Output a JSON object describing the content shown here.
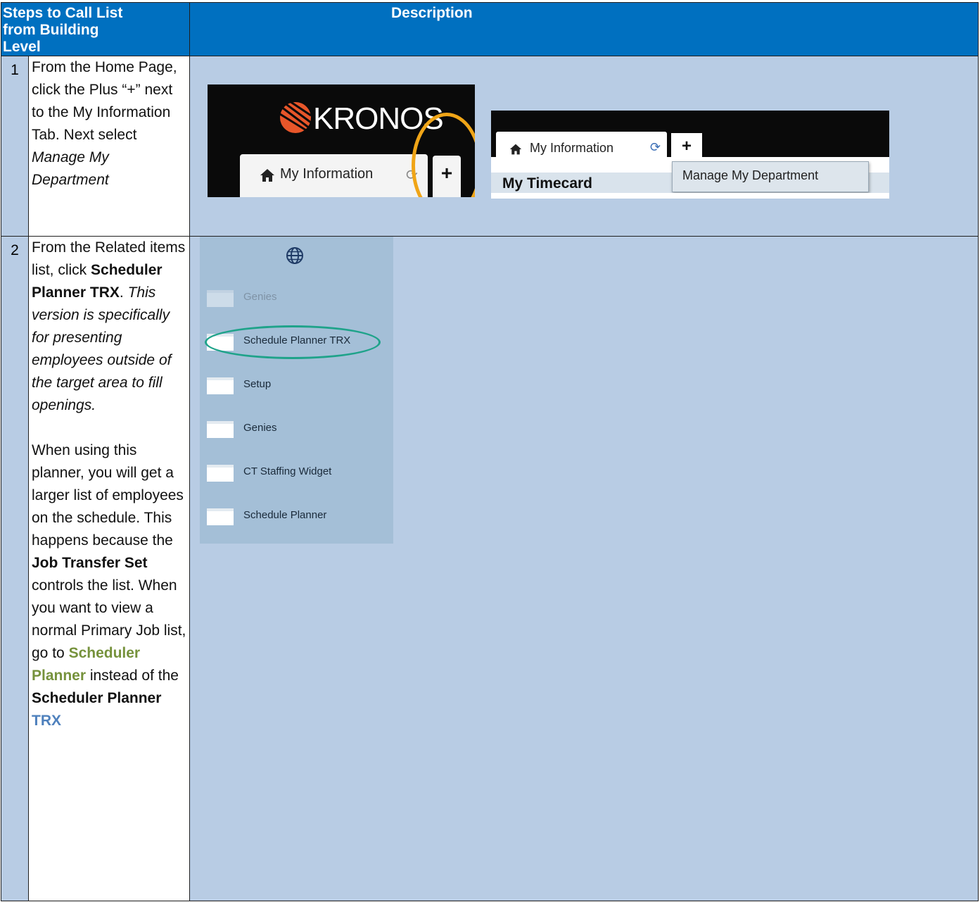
{
  "header": {
    "title": "Steps to Call List from Building Level",
    "description": "Description"
  },
  "step1": {
    "number": "1",
    "text_plain": "From the Home Page, click the Plus “+” next to the My Information Tab. Next select",
    "text_italic": "Manage My Department",
    "shot1": {
      "logo_text": "KRONOS",
      "tab_label": "My Information",
      "plus": "+"
    },
    "shot2": {
      "tab_label": "My Information",
      "plus": "+",
      "row_label": "My Timecard",
      "dropdown_item": "Manage My Department"
    },
    "colors": {
      "ring": "#f0a517",
      "header_bg": "#0070c0",
      "cell_bg": "#b8cce4"
    }
  },
  "step2": {
    "number": "2",
    "p1_a": "From the Related items list, click",
    "p1_bold": "Scheduler Planner TRX",
    "p1_end": ".",
    "p1_italic": "This version is specifically for presenting employees outside of the target area to fill openings.",
    "p2_a": "When using this planner, you will get a larger list of employees on the schedule. This happens because the",
    "p2_bold1": "Job Transfer Set",
    "p2_b": "controls the list. When you want to view a normal Primary Job list, go to",
    "p2_green": "Scheduler Planner",
    "p2_c": "instead of the",
    "p2_bold2": "Scheduler Planner",
    "p2_blue": "TRX",
    "related_items": [
      {
        "label": "Genies"
      },
      {
        "label": "Schedule Planner TRX"
      },
      {
        "label": "Setup"
      },
      {
        "label": "Genies"
      },
      {
        "label": "CT Staffing Widget"
      },
      {
        "label": "Schedule Planner"
      }
    ],
    "colors": {
      "oval": "#1fa38a",
      "green": "#76923c",
      "blue": "#4f81bd"
    }
  }
}
